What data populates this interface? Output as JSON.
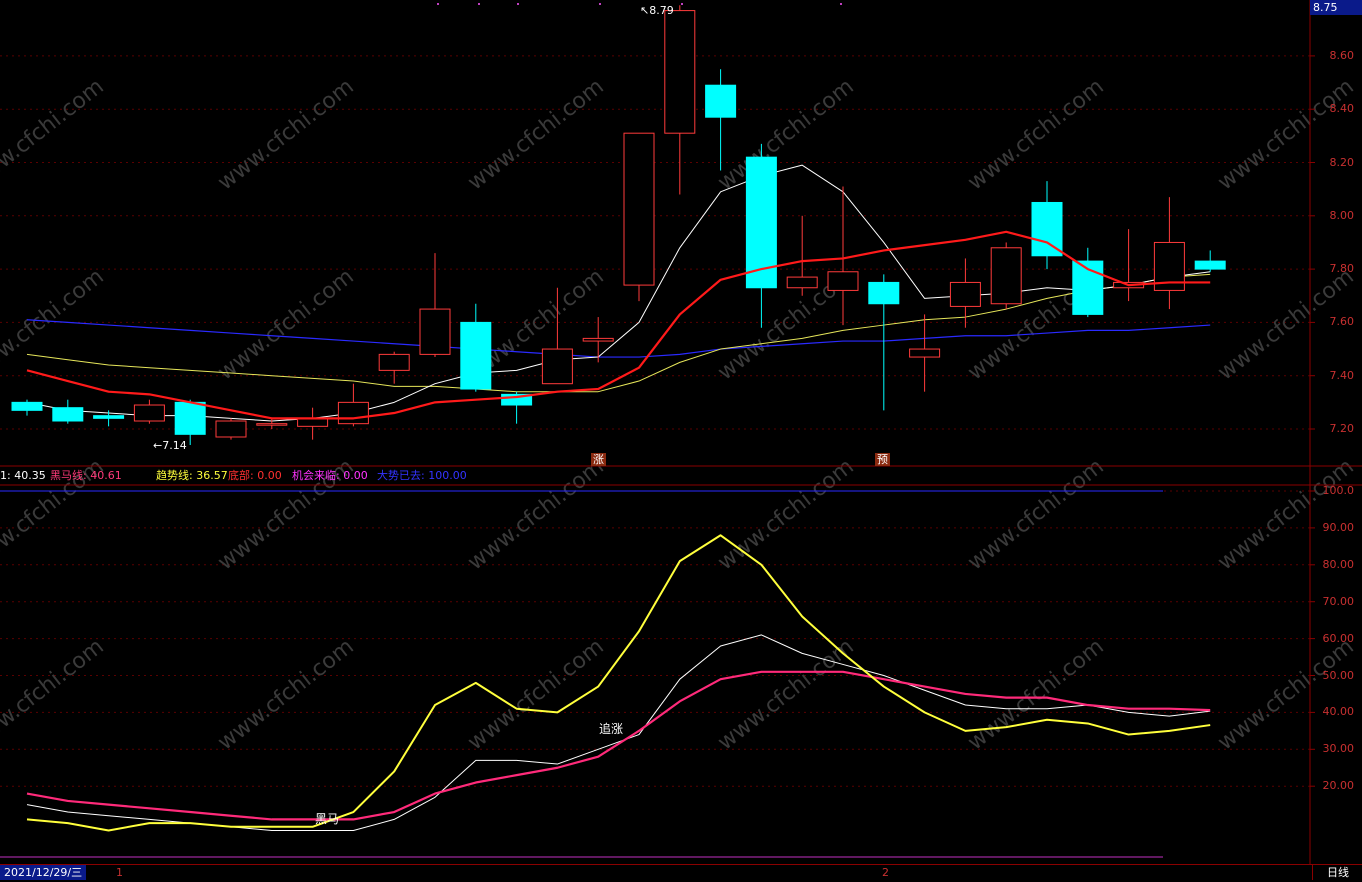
{
  "top_price": "8.75",
  "price_axis": [
    "8.60",
    "8.40",
    "8.20",
    "8.00",
    "7.80",
    "7.60",
    "7.40",
    "7.20"
  ],
  "osc_axis": [
    "100.0",
    "90.00",
    "80.00",
    "70.00",
    "60.00",
    "50.00",
    "40.00",
    "30.00",
    "20.00"
  ],
  "indicator_legend": [
    {
      "label": "1: 40.35",
      "color": "#ffffff"
    },
    {
      "label": "黑马线: 40.61",
      "color": "#ff3a7a"
    },
    {
      "label": "趋势线: 36.57",
      "color": "#ffff3c"
    },
    {
      "label": "底部: 0.00",
      "color": "#ff3030"
    },
    {
      "label": "机会来临: 0.00",
      "color": "#ff33ff"
    },
    {
      "label": "大势已去: 100.00",
      "color": "#3333ff"
    }
  ],
  "annotations": {
    "high_label": "8.79",
    "low_label": "7.14",
    "signal_zhang": "涨",
    "signal_yu": "预",
    "chase_label": "追涨",
    "dark_horse_label": "黑马"
  },
  "bottom_bar": {
    "date": "2021/12/29/三",
    "marker_1": "1",
    "marker_2": "2",
    "period": "日线"
  },
  "watermark": "www.cfchi.com",
  "colors": {
    "up": "#ff3b3b",
    "down": "#00ffff",
    "ma_white": "#ffffff",
    "ma_yellow": "#e6e65a",
    "ma_red": "#ff1a1a",
    "ma_blue": "#2a2aff",
    "axis": "#8a0000"
  },
  "candles": [
    {
      "o": 7.3,
      "c": 7.27,
      "h": 7.31,
      "l": 7.25
    },
    {
      "o": 7.28,
      "c": 7.23,
      "h": 7.31,
      "l": 7.22
    },
    {
      "o": 7.25,
      "c": 7.24,
      "h": 7.27,
      "l": 7.21
    },
    {
      "o": 7.23,
      "c": 7.29,
      "h": 7.31,
      "l": 7.22
    },
    {
      "o": 7.3,
      "c": 7.18,
      "h": 7.31,
      "l": 7.14
    },
    {
      "o": 7.17,
      "c": 7.23,
      "h": 7.24,
      "l": 7.16
    },
    {
      "o": 7.22,
      "c": 7.22,
      "h": 7.24,
      "l": 7.2
    },
    {
      "o": 7.21,
      "c": 7.24,
      "h": 7.28,
      "l": 7.16
    },
    {
      "o": 7.22,
      "c": 7.3,
      "h": 7.37,
      "l": 7.21
    },
    {
      "o": 7.42,
      "c": 7.48,
      "h": 7.49,
      "l": 7.37
    },
    {
      "o": 7.48,
      "c": 7.65,
      "h": 7.86,
      "l": 7.47
    },
    {
      "o": 7.6,
      "c": 7.35,
      "h": 7.67,
      "l": 7.34
    },
    {
      "o": 7.33,
      "c": 7.29,
      "h": 7.34,
      "l": 7.22
    },
    {
      "o": 7.37,
      "c": 7.5,
      "h": 7.73,
      "l": 7.37
    },
    {
      "o": 7.53,
      "c": 7.54,
      "h": 7.62,
      "l": 7.45
    },
    {
      "o": 7.74,
      "c": 8.31,
      "h": 8.31,
      "l": 7.68
    },
    {
      "o": 8.31,
      "c": 8.77,
      "h": 8.79,
      "l": 8.08
    },
    {
      "o": 8.49,
      "c": 8.37,
      "h": 8.55,
      "l": 8.17
    },
    {
      "o": 8.22,
      "c": 7.73,
      "h": 8.27,
      "l": 7.58
    },
    {
      "o": 7.73,
      "c": 7.77,
      "h": 8.0,
      "l": 7.7
    },
    {
      "o": 7.72,
      "c": 7.79,
      "h": 8.11,
      "l": 7.59
    },
    {
      "o": 7.75,
      "c": 7.67,
      "h": 7.78,
      "l": 7.27
    },
    {
      "o": 7.47,
      "c": 7.5,
      "h": 7.63,
      "l": 7.34
    },
    {
      "o": 7.66,
      "c": 7.75,
      "h": 7.84,
      "l": 7.58
    },
    {
      "o": 7.67,
      "c": 7.88,
      "h": 7.9,
      "l": 7.65
    },
    {
      "o": 8.05,
      "c": 7.85,
      "h": 8.13,
      "l": 7.8
    },
    {
      "o": 7.83,
      "c": 7.63,
      "h": 7.88,
      "l": 7.62
    },
    {
      "o": 7.73,
      "c": 7.75,
      "h": 7.95,
      "l": 7.68
    },
    {
      "o": 7.72,
      "c": 7.9,
      "h": 8.07,
      "l": 7.65
    },
    {
      "o": 7.83,
      "c": 7.8,
      "h": 7.87,
      "l": 7.79
    }
  ],
  "ma_white": [
    7.3,
    7.27,
    7.26,
    7.25,
    7.25,
    7.24,
    7.23,
    7.24,
    7.26,
    7.3,
    7.37,
    7.41,
    7.42,
    7.46,
    7.47,
    7.6,
    7.88,
    8.09,
    8.15,
    8.19,
    8.09,
    7.9,
    7.69,
    7.7,
    7.71,
    7.73,
    7.72,
    7.74,
    7.77,
    7.79
  ],
  "ma_yellow": [
    7.48,
    7.46,
    7.44,
    7.43,
    7.42,
    7.41,
    7.4,
    7.39,
    7.38,
    7.36,
    7.36,
    7.35,
    7.34,
    7.34,
    7.34,
    7.38,
    7.45,
    7.5,
    7.52,
    7.54,
    7.57,
    7.59,
    7.61,
    7.62,
    7.65,
    7.69,
    7.72,
    7.74,
    7.77,
    7.78
  ],
  "ma_red": [
    7.42,
    7.38,
    7.34,
    7.33,
    7.3,
    7.27,
    7.24,
    7.24,
    7.24,
    7.26,
    7.3,
    7.31,
    7.32,
    7.34,
    7.35,
    7.43,
    7.63,
    7.76,
    7.8,
    7.83,
    7.84,
    7.87,
    7.89,
    7.91,
    7.94,
    7.9,
    7.8,
    7.74,
    7.75,
    7.75
  ],
  "ma_blue": [
    7.61,
    7.6,
    7.59,
    7.58,
    7.57,
    7.56,
    7.55,
    7.54,
    7.53,
    7.52,
    7.51,
    7.5,
    7.49,
    7.48,
    7.47,
    7.47,
    7.48,
    7.5,
    7.51,
    7.52,
    7.53,
    7.53,
    7.54,
    7.55,
    7.55,
    7.56,
    7.57,
    7.57,
    7.58,
    7.59
  ],
  "osc_white": [
    15,
    13,
    12,
    11,
    10,
    9,
    8,
    8,
    8,
    11,
    17,
    27,
    27,
    26,
    30,
    34,
    49,
    58,
    61,
    56,
    53,
    50,
    46,
    42,
    41,
    41,
    42,
    40,
    39,
    40.35
  ],
  "osc_yellow": [
    11,
    10,
    8,
    10,
    10,
    9,
    9,
    9,
    13,
    24,
    42,
    48,
    41,
    40,
    47,
    62,
    81,
    88,
    80,
    66,
    56,
    47,
    40,
    35,
    36,
    38,
    37,
    34,
    35,
    36.57
  ],
  "osc_pink": [
    18,
    16,
    15,
    14,
    13,
    12,
    11,
    11,
    11,
    13,
    18,
    21,
    23,
    25,
    28,
    35,
    43,
    49,
    51,
    51,
    51,
    49,
    47,
    45,
    44,
    44,
    42,
    41,
    41,
    40.61
  ]
}
